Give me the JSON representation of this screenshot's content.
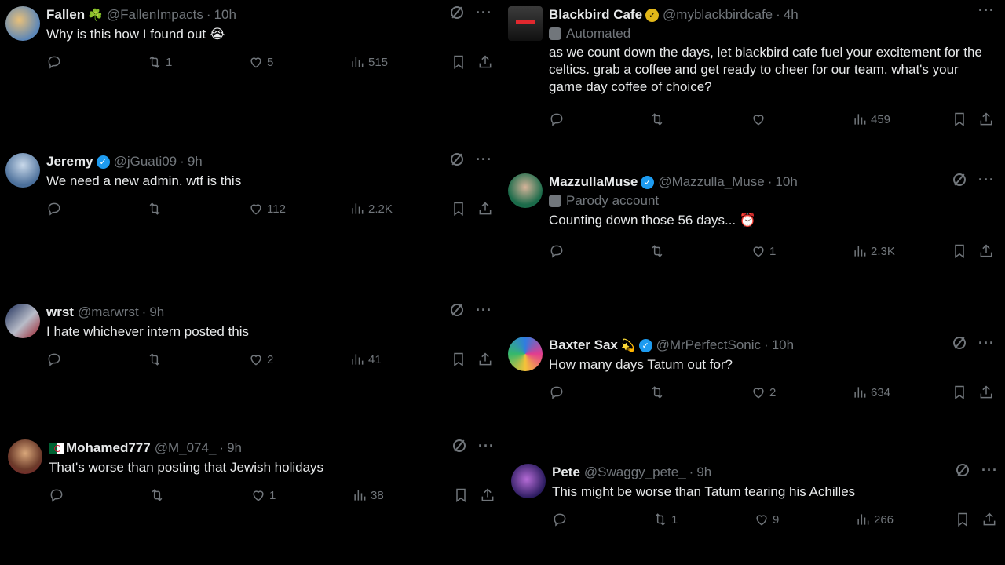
{
  "colors": {
    "background": "#000000",
    "text": "#e7e9ea",
    "muted": "#71767b",
    "verified": "#1d9bf0",
    "gold_verified": "#e2b719"
  },
  "tweets": [
    {
      "name": "Fallen",
      "name_emoji": "☘️",
      "handle": "@FallenImpacts",
      "time": "10h",
      "verified": "",
      "label": "",
      "text": "Why is this how I found out 😭",
      "replies": "",
      "retweets": "1",
      "likes": "5",
      "views": "515"
    },
    {
      "name": "Jeremy",
      "handle": "@jGuati09",
      "time": "9h",
      "verified": "blue",
      "label": "",
      "text": "We need a new admin. wtf is this",
      "replies": "",
      "retweets": "",
      "likes": "112",
      "views": "2.2K"
    },
    {
      "name": "wrst",
      "handle": "@marwrst",
      "time": "9h",
      "verified": "",
      "label": "",
      "text": "I hate whichever intern posted this",
      "replies": "",
      "retweets": "",
      "likes": "2",
      "views": "41"
    },
    {
      "name": "Mohamed777",
      "handle": "@M_074_",
      "time": "9h",
      "verified": "",
      "label": "",
      "text": "That's worse than posting that Jewish holidays",
      "replies": "",
      "retweets": "",
      "likes": "1",
      "views": "38"
    },
    {
      "name": "Blackbird Cafe",
      "handle": "@myblackbirdcafe",
      "time": "4h",
      "verified": "gold",
      "label": "Automated",
      "text": "as we count down the days, let blackbird cafe fuel your excitement for the celtics. grab a coffee and get ready to cheer for our team. what's your game day coffee of choice?",
      "replies": "",
      "retweets": "",
      "likes": "",
      "views": "459"
    },
    {
      "name": "MazzullaMuse",
      "handle": "@Mazzulla_Muse",
      "time": "10h",
      "verified": "blue",
      "label": "Parody account",
      "text": "Counting down those 56 days... ⏰",
      "replies": "",
      "retweets": "",
      "likes": "1",
      "views": "2.3K"
    },
    {
      "name": "Baxter Sax",
      "name_emoji": "💫",
      "handle": "@MrPerfectSonic",
      "time": "10h",
      "verified": "blue",
      "label": "",
      "text": "How many days Tatum out for?",
      "replies": "",
      "retweets": "",
      "likes": "2",
      "views": "634"
    },
    {
      "name": "Pete",
      "handle": "@Swaggy_pete_",
      "time": "9h",
      "verified": "",
      "label": "",
      "text": "This might be worse than Tatum tearing his Achilles",
      "replies": "",
      "retweets": "1",
      "likes": "9",
      "views": "266"
    }
  ],
  "separator": "·",
  "more_icon": "···"
}
